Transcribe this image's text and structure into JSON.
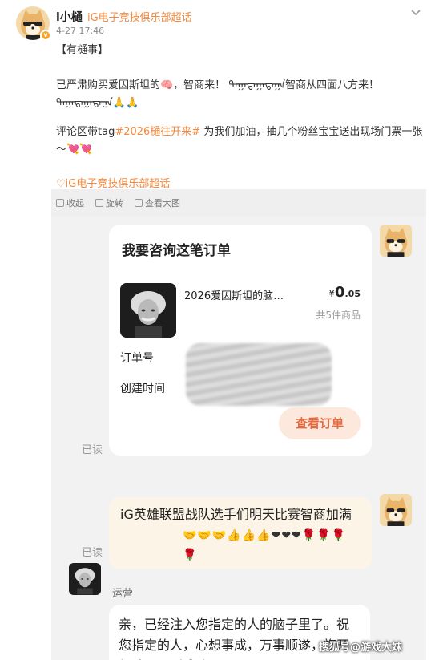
{
  "post": {
    "username": "i小樋",
    "super_tag": "iG电子竞技俱乐部超话",
    "time": "4-27 17:46",
    "headline": "【有樋事】",
    "paragraph1": "已严肃购买爱因斯坦的🧠，智商来！ ᠳᠠᠭᠠᠳᠠᠭᠠᠳᠠᠭᠠ智商从四面八方来！ ᠳᠠᠭᠠᠳᠠᠭᠠᠳᠠᠭᠠ🙏🙏",
    "paragraph2_pre": "评论区带tag",
    "paragraph2_tag": "#2026樋往开来#",
    "paragraph2_post": " 为我们加油，抽几个粉丝宝宝送出现场门票一张～💘💘",
    "superlink": "♡iG电子竞技俱乐部超话"
  },
  "toolbar": {
    "collect": "收起",
    "rotate": "旋转",
    "view_large": "查看大图"
  },
  "chat": {
    "order_card": {
      "title": "我要咨询这笔订单",
      "product_name": "2026爱因斯坦的脑…",
      "price_symbol": "¥",
      "price_int": "0",
      "price_dec": ".05",
      "count": "共5件商品",
      "order_no_label": "订单号",
      "created_label": "创建时间",
      "view_button": "查看订单"
    },
    "read_label_1": "已读",
    "read_label_2": "已读",
    "message_text": "iG英雄联盟战队选手们明天比赛智商加满",
    "message_emojis": "🤝🤝🤝👍👍👍❤❤❤🌹🌹🌹🌹",
    "reply_name": "运营",
    "reply_text": "亲，已经注入您指定的人的脑子里了。祝您指定的人，心想事成，万事顺遂，旗开得胜，马到成功。"
  },
  "watermark": "搜狐号@游戏大妹",
  "colors": {
    "accent": "#f5883a",
    "button_bg": "#fde8de",
    "button_text": "#e56a3e"
  }
}
